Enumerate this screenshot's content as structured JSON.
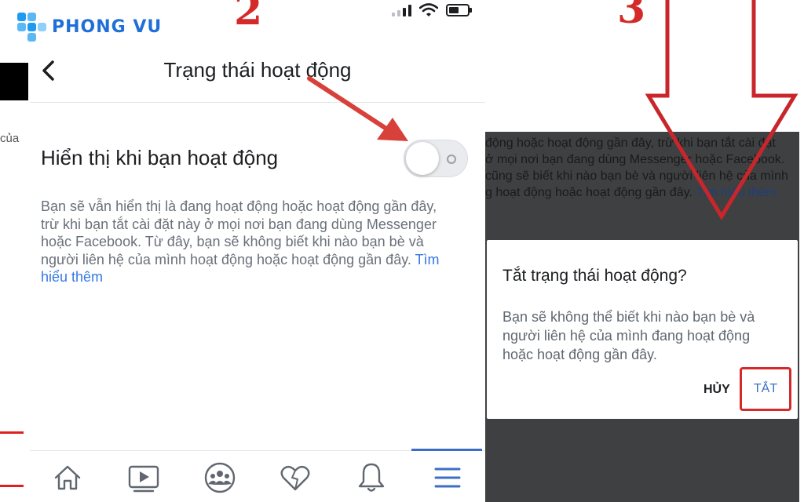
{
  "brand": {
    "name": "PHONG VU"
  },
  "steps": {
    "two": "2",
    "three": "3"
  },
  "left_panel": {
    "fragment": "của"
  },
  "screen": {
    "title": "Trạng thái hoạt động",
    "setting_label": "Hiển thị khi bạn hoạt động",
    "toggle_on": false,
    "description": "Bạn sẽ vẫn hiển thị là đang hoạt động hoặc hoạt động gần đây, trừ khi bạn tắt cài đặt này ở mọi nơi bạn đang dùng Messenger hoặc Facebook. Từ đây, bạn sẽ không biết khi nào bạn bè và người liên hệ của mình hoạt động hoặc hoạt động gần đây.",
    "learn_more": "Tìm hiểu thêm"
  },
  "nav": {
    "items": [
      "home-icon",
      "video-icon",
      "groups-icon",
      "dating-icon",
      "bell-icon",
      "menu-icon"
    ],
    "active": "menu-icon"
  },
  "background_text": {
    "line1": "động hoặc hoạt động gần đây, trừ khi bạn tắt cài đặt",
    "line2": "ở mọi nơi bạn đang dùng Messenger hoặc Facebook.",
    "line3": "cũng sẽ biết khi nào bạn bè và người liên hệ của mình",
    "line4": "g hoạt động hoặc hoạt động gần đây.",
    "line4_link": "Tìm hiểu thêm"
  },
  "dialog": {
    "title": "Tắt trạng thái hoạt động?",
    "body": "Bạn sẽ không thể biết khi nào bạn bè và người liên hệ của mình đang hoạt động hoặc hoạt động gần đây.",
    "cancel": "HỦY",
    "confirm": "TẮT"
  },
  "colors": {
    "accent": "#3b6fc7",
    "highlight_red": "#d42a2a",
    "link": "#3578e5",
    "brand_blue": "#1f6fd8"
  }
}
